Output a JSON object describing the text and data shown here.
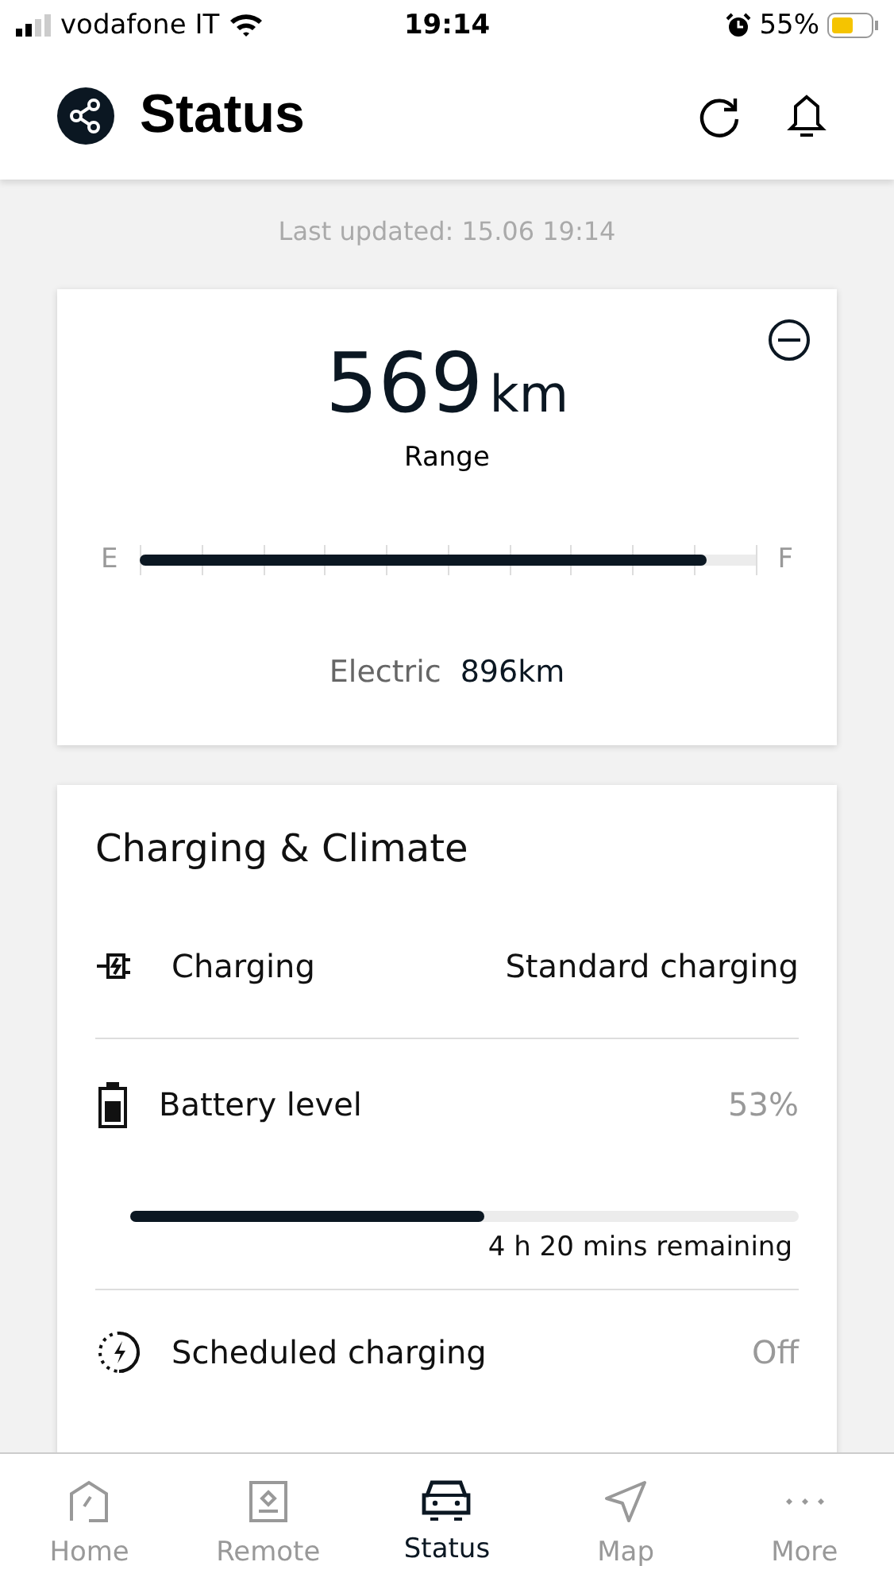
{
  "status_bar": {
    "carrier": "vodafone IT",
    "time": "19:14",
    "battery": "55%"
  },
  "header": {
    "title": "Status"
  },
  "last_updated": "Last updated: 15.06 19:14",
  "range_card": {
    "value": "569",
    "unit": "km",
    "label": "Range",
    "gauge_start": "E",
    "gauge_end": "F",
    "level": 0.92,
    "electric_label": "Electric",
    "electric_value": "896km"
  },
  "charging_card": {
    "title": "Charging & Climate",
    "rows": [
      {
        "kind": "value",
        "label": "Charging",
        "value": "Standard charging",
        "muted": false
      },
      {
        "kind": "progress",
        "label": "Battery level",
        "value": "53%",
        "muted": true,
        "level": 0.53,
        "remaining": "4 h 20 mins remaining"
      },
      {
        "kind": "value",
        "label": "Scheduled charging",
        "value": "Off",
        "muted": true
      }
    ]
  },
  "tabs": [
    {
      "label": "Home",
      "selected": false
    },
    {
      "label": "Remote",
      "selected": false
    },
    {
      "label": "Status",
      "selected": true
    },
    {
      "label": "Map",
      "selected": false
    },
    {
      "label": "More",
      "selected": false
    }
  ]
}
